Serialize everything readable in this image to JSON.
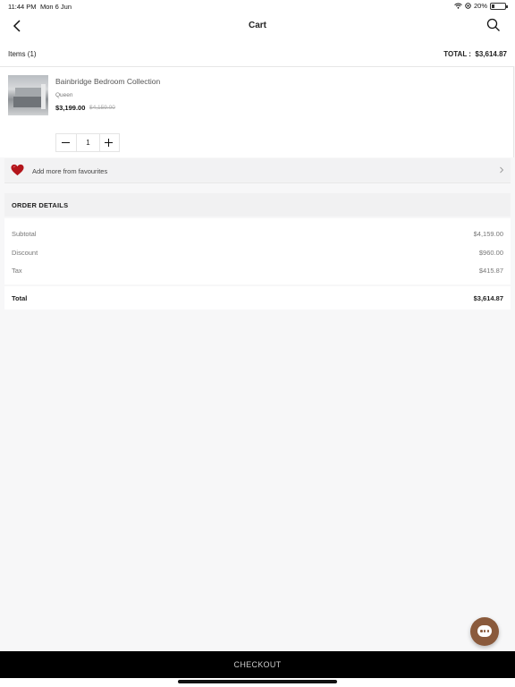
{
  "status": {
    "time": "11:44 PM",
    "date": "Mon 6 Jun",
    "battery": "20%",
    "battery_level": 0.2
  },
  "header": {
    "title": "Cart",
    "back_icon": "chevron-left-icon",
    "search_icon": "search-icon"
  },
  "items_bar": {
    "items_label": "Items (1)",
    "total_label": "TOTAL :",
    "total_value": "$3,614.87"
  },
  "cart_item": {
    "name": "Bainbridge Bedroom Collection",
    "variant": "Queen",
    "price": "$3,199.00",
    "original_price": "$4,159.00",
    "quantity": "1"
  },
  "favourites": {
    "label": "Add more from favourites",
    "icon": "heart-icon",
    "heart_color": "#b3151b"
  },
  "order_details": {
    "heading": "ORDER DETAILS",
    "rows": [
      {
        "label": "Subtotal",
        "value": "$4,159.00"
      },
      {
        "label": "Discount",
        "value": "$960.00"
      },
      {
        "label": "Tax",
        "value": "$415.87"
      }
    ],
    "total_label": "Total",
    "total_value": "$3,614.87"
  },
  "checkout": {
    "label": "CHECKOUT"
  },
  "chat": {
    "icon": "chat-bubble-icon",
    "color": "#8a5a3c"
  }
}
